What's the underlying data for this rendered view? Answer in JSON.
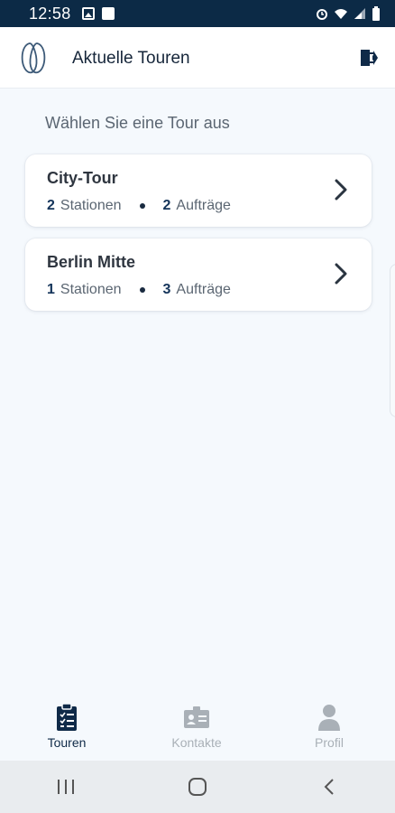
{
  "status_bar": {
    "time": "12:58",
    "icons": [
      "image-icon",
      "check-box-icon",
      "alarm-icon",
      "wifi-icon",
      "signal-icon",
      "battery-icon"
    ]
  },
  "app_bar": {
    "title": "Aktuelle Touren",
    "logo_icon": "app-logo-icon",
    "logout_icon": "logout-icon"
  },
  "main": {
    "subtitle": "Wählen Sie eine Tour aus",
    "tours": [
      {
        "name": "City-Tour",
        "stations_count": "2",
        "stations_label": "Stationen",
        "orders_count": "2",
        "orders_label": "Aufträge"
      },
      {
        "name": "Berlin Mitte",
        "stations_count": "1",
        "stations_label": "Stationen",
        "orders_count": "3",
        "orders_label": "Aufträge"
      }
    ]
  },
  "bottom_nav": {
    "items": [
      {
        "label": "Touren",
        "icon": "clipboard-list-icon",
        "active": true
      },
      {
        "label": "Kontakte",
        "icon": "contact-card-icon",
        "active": false
      },
      {
        "label": "Profil",
        "icon": "user-icon",
        "active": false
      }
    ]
  },
  "system_nav": {
    "icons": [
      "recent-apps-icon",
      "home-icon",
      "back-icon"
    ]
  },
  "colors": {
    "status_bar": "#0c2a46",
    "background": "#f5f9fd",
    "accent": "#14345a",
    "inactive": "#a9b0b7"
  }
}
